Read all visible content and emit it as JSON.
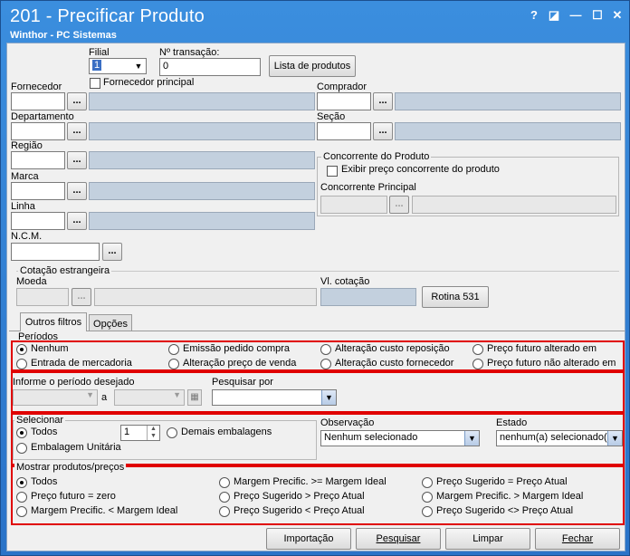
{
  "window": {
    "title": "201 - Precificar Produto",
    "subtitle": "Winthor - PC Sistemas",
    "controls": {
      "help": "?",
      "edit": "◪",
      "minimize": "—",
      "maximize": "☐",
      "close": "✕"
    }
  },
  "header": {
    "filial_label": "Filial",
    "filial_value": "1",
    "transacao_label": "Nº transação:",
    "transacao_value": "0",
    "lista_button": "Lista de produtos",
    "fornecedor_principal_label": "Fornecedor principal"
  },
  "fields": {
    "fornecedor": "Fornecedor",
    "departamento": "Departamento",
    "regiao": "Região",
    "marca": "Marca",
    "linha": "Linha",
    "ncm": "N.C.M.",
    "comprador": "Comprador",
    "secao": "Seção",
    "browse": "..."
  },
  "concorrente": {
    "title": "Concorrente do Produto",
    "exibir_label": "Exibir preço concorrente do produto",
    "principal_label": "Concorrente Principal"
  },
  "cotacao": {
    "title": "Cotação estrangeira",
    "moeda_label": "Moeda",
    "vl_label": "Vl. cotação",
    "rotina_button": "Rotina 531"
  },
  "tabs": [
    {
      "label": "Outros filtros"
    },
    {
      "label": "Opções"
    }
  ],
  "periodos": {
    "title": "Períodos",
    "options": [
      "Nenhum",
      "Emissão pedido compra",
      "Alteração custo reposição",
      "Preço futuro alterado em",
      "Entrada de mercadoria",
      "Alteração preço de venda",
      "Alteração custo fornecedor",
      "Preço futuro não alterado em"
    ],
    "informe_label": "Informe o período desejado",
    "a_label": "a",
    "pesquisar_por_label": "Pesquisar por"
  },
  "selecionar": {
    "title": "Selecionar",
    "todos": "Todos",
    "qty": "1",
    "demais": "Demais embalagens",
    "unitaria": "Embalagem Unitária",
    "observacao_label": "Observação",
    "observacao_value": "Nenhum selecionado",
    "estado_label": "Estado",
    "estado_value": "nenhum(a) selecionado(a)"
  },
  "mostrar": {
    "title": "Mostrar produtos/preços",
    "options": [
      "Todos",
      "Margem Precific. >= Margem Ideal",
      "Preço Sugerido = Preço Atual",
      "Preço futuro = zero",
      "Preço Sugerido > Preço Atual",
      "Margem Precific. > Margem Ideal",
      "Margem Precific. < Margem Ideal",
      "Preço Sugerido < Preço Atual",
      "Preço Sugerido <> Preço Atual"
    ]
  },
  "footer": {
    "importacao": "Importação",
    "pesquisar": "Pesquisar",
    "limpar": "Limpar",
    "fechar": "Fechar"
  }
}
